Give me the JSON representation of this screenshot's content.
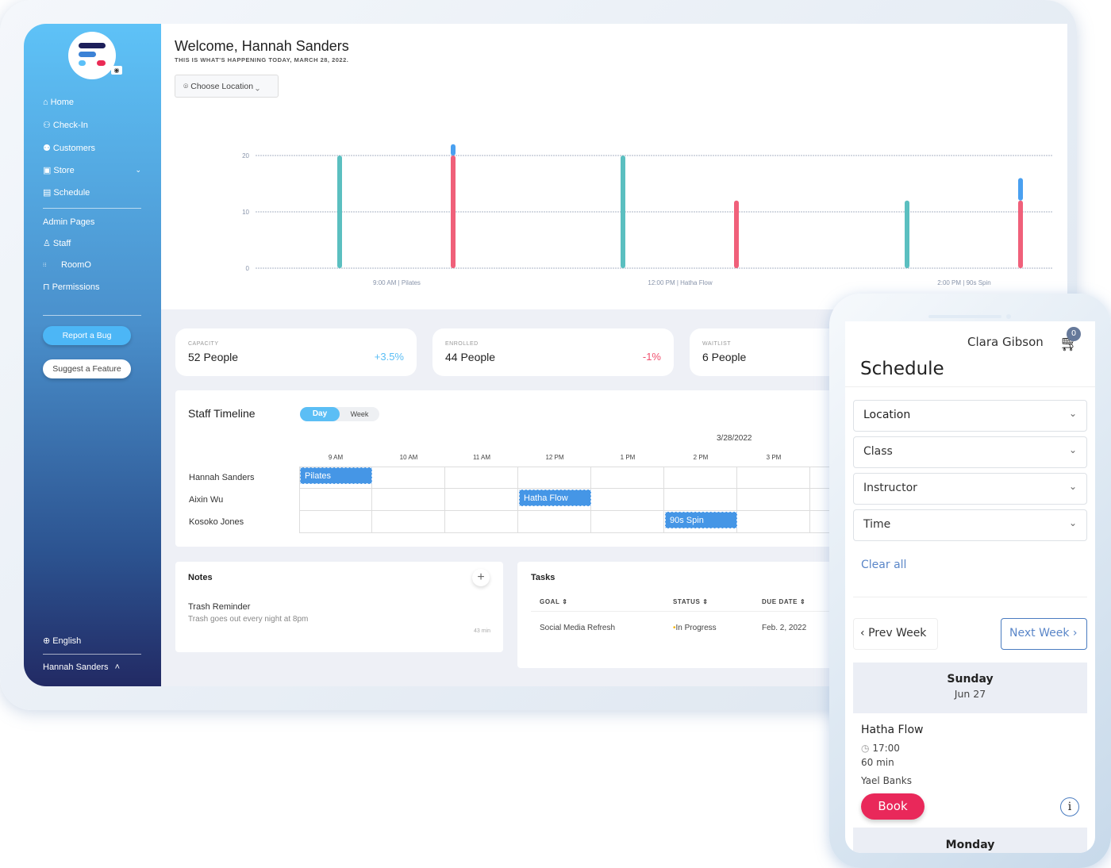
{
  "sidebar": {
    "items": [
      {
        "label": "Home",
        "icon": "home-icon"
      },
      {
        "label": "Check-In",
        "icon": "user-check-icon"
      },
      {
        "label": "Customers",
        "icon": "users-icon"
      },
      {
        "label": "Store",
        "icon": "store-icon"
      },
      {
        "label": "Schedule",
        "icon": "calendar-icon"
      }
    ],
    "admin_title": "Admin Pages",
    "admin_items": [
      {
        "label": "Staff",
        "icon": "user-icon"
      },
      {
        "label": "RoomO",
        "icon": "grid-icon"
      },
      {
        "label": "Permissions",
        "icon": "lock-icon"
      }
    ],
    "report_bug": "Report a Bug",
    "suggest_feature": "Suggest a Feature",
    "language": "English",
    "user": "Hannah Sanders"
  },
  "header": {
    "title": "Welcome, Hannah Sanders",
    "subtitle": "THIS IS WHAT'S HAPPENING TODAY, MARCH 28, 2022.",
    "location_button": "Choose Location"
  },
  "chart_data": {
    "type": "bar",
    "categories": [
      "9:00 AM | Pilates",
      "12:00 PM | Hatha Flow",
      "2:00 PM | 90s Spin"
    ],
    "series": [
      {
        "key": "capacity",
        "values": [
          20,
          20,
          12
        ],
        "color": "#5bbfc0"
      },
      {
        "key": "enrolled",
        "values": [
          20,
          12,
          12
        ],
        "color": "#f0607a"
      },
      {
        "key": "waitlist",
        "values": [
          2,
          0,
          4
        ],
        "color": "#4aa0f0",
        "stacked_on": "enrolled"
      }
    ],
    "yticks": [
      "0",
      "10",
      "20"
    ],
    "ylim": [
      0,
      22
    ],
    "grid": true
  },
  "stats": [
    {
      "label": "CAPACITY",
      "value": "52 People",
      "change": "+3.5%",
      "change_color": "#5bbef5"
    },
    {
      "label": "ENROLLED",
      "value": "44 People",
      "change": "-1%",
      "change_color": "#f0506e"
    },
    {
      "label": "WAITLIST",
      "value": "6 People"
    }
  ],
  "timeline": {
    "title": "Staff Timeline",
    "toggle": [
      "Day",
      "Week"
    ],
    "date": "3/28/2022",
    "hours": [
      "9 AM",
      "10 AM",
      "11 AM",
      "12 PM",
      "1 PM",
      "2 PM",
      "3 PM"
    ],
    "staff": [
      "Hannah Sanders",
      "Aixin Wu",
      "Kosoko Jones"
    ],
    "events": [
      {
        "label": "Pilates"
      },
      {
        "label": "Hatha Flow"
      },
      {
        "label": "90s Spin"
      }
    ]
  },
  "notes": {
    "title": "Notes",
    "item_title": "Trash Reminder",
    "item_text": "Trash goes out every night at 8pm",
    "item_time": "43 min"
  },
  "tasks": {
    "title": "Tasks",
    "headers": [
      "GOAL",
      "STATUS",
      "DUE DATE"
    ],
    "rows": [
      {
        "goal": "Social Media Refresh",
        "status": "In Progress",
        "due": "Feb. 2, 2022"
      }
    ]
  },
  "phone": {
    "user": "Clara Gibson",
    "cart_count": "0",
    "title": "Schedule",
    "filters": [
      "Location",
      "Class",
      "Instructor",
      "Time"
    ],
    "clear_all": "Clear all",
    "prev_week": "Prev Week",
    "next_week": "Next Week",
    "day": "Sunday",
    "date": "Jun 27",
    "class_name": "Hatha Flow",
    "time": "17:00",
    "duration": "60 min",
    "instructor": "Yael Banks",
    "book": "Book",
    "next_day": "Monday"
  }
}
